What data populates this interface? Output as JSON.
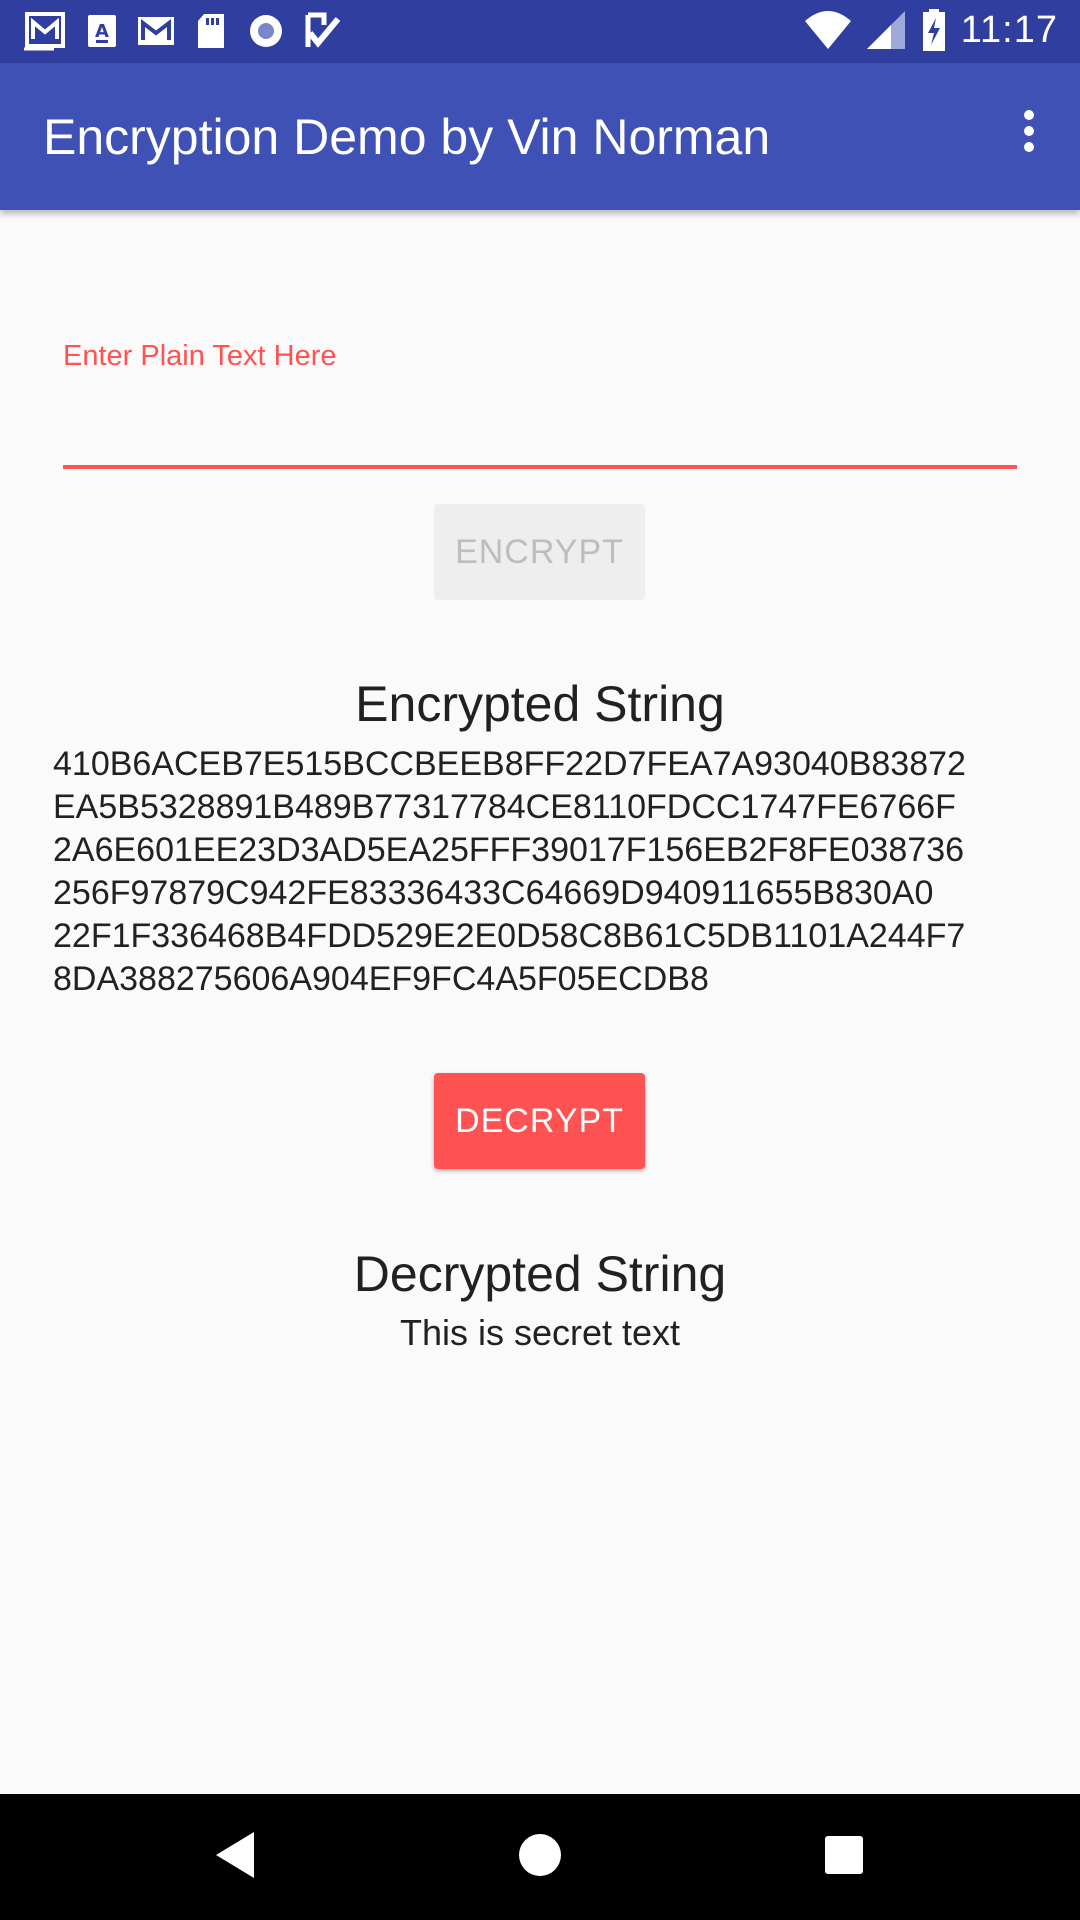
{
  "status_bar": {
    "time": "11:17",
    "icons": [
      "gmail-icon",
      "font-app-icon",
      "gmail-icon",
      "sd-card-icon",
      "record-icon",
      "check-icon"
    ],
    "right_icons": [
      "wifi-icon",
      "signal-icon",
      "battery-charging-icon"
    ]
  },
  "app_bar": {
    "title": "Encryption Demo by Vin Norman",
    "overflow_icon": "more-vert-icon",
    "background": "#3f51b5",
    "status_background": "#303f9f"
  },
  "input": {
    "label": "Enter Plain Text Here",
    "value": "",
    "accent": "#ff5252"
  },
  "buttons": {
    "encrypt_label": "ENCRYPT",
    "decrypt_label": "DECRYPT"
  },
  "encrypted": {
    "heading": "Encrypted String",
    "lines": [
      "410B6ACEB7E515BCCBEEB8FF22D7FEA7A93040B83872",
      "EA5B5328891B489B77317784CE8110FDCC1747FE6766F",
      "2A6E601EE23D3AD5EA25FFF39017F156EB2F8FE038736",
      "256F97879C942FE83336433C64669D940911655B830A0",
      "22F1F336468B4FDD529E2E0D58C8B61C5DB1101A244F7",
      "8DA388275606A904EF9FC4A5F05ECDB8"
    ]
  },
  "decrypted": {
    "heading": "Decrypted String",
    "value": "This is secret text"
  },
  "nav_bar": {
    "icons": [
      "back-icon",
      "home-icon",
      "recents-icon"
    ]
  }
}
